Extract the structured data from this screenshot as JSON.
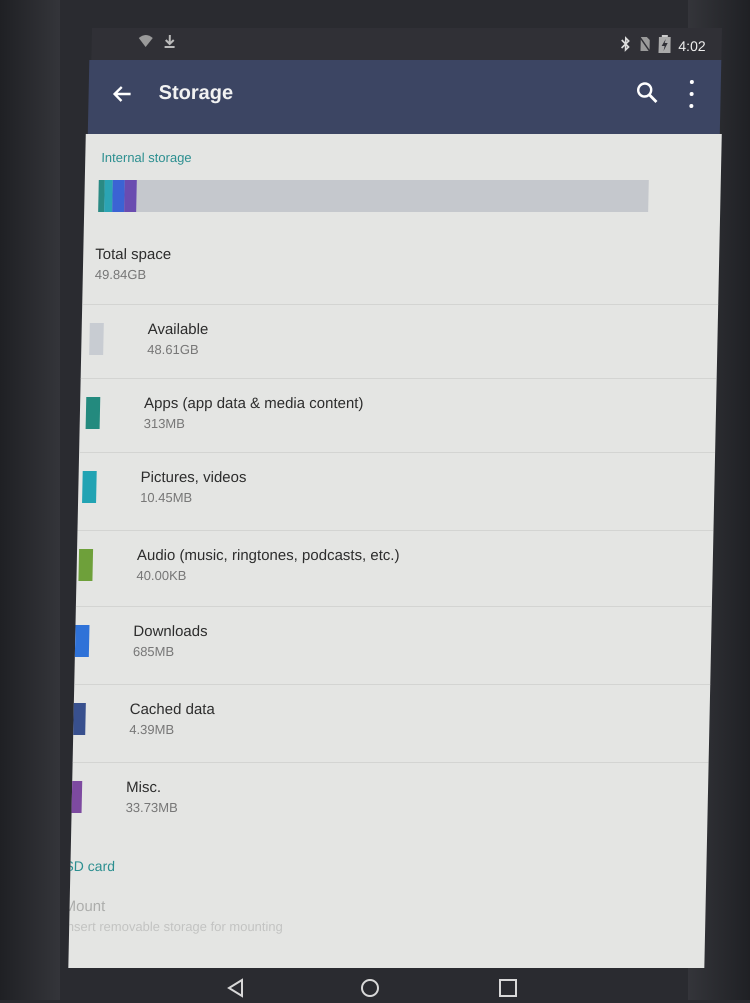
{
  "status_bar": {
    "left_icons": [
      "wifi-icon",
      "download-icon"
    ],
    "right_icons": [
      "bluetooth-icon",
      "no-sim-icon",
      "battery-icon"
    ],
    "time": "4:02"
  },
  "app_bar": {
    "title": "Storage",
    "icons": [
      "back-arrow-icon",
      "search-icon",
      "more-vert-icon"
    ]
  },
  "internal_storage": {
    "header": "Internal storage",
    "bar_segments": [
      {
        "color": "#2a8a84"
      },
      {
        "color": "#2ba4b4"
      },
      {
        "color": "#3b63d4"
      },
      {
        "color": "#6a4cb0"
      }
    ],
    "total": {
      "label": "Total space",
      "value": "49.84GB"
    },
    "items": [
      {
        "label": "Available",
        "value": "48.61GB",
        "color": "#c8ccd2"
      },
      {
        "label": "Apps (app data & media content)",
        "value": "313MB",
        "color": "#238a7e"
      },
      {
        "label": "Pictures, videos",
        "value": "10.45MB",
        "color": "#21a3b3"
      },
      {
        "label": "Audio (music, ringtones, podcasts, etc.)",
        "value": "40.00KB",
        "color": "#6ea03a"
      },
      {
        "label": "Downloads",
        "value": "685MB",
        "color": "#2f72d8"
      },
      {
        "label": "Cached data",
        "value": "4.39MB",
        "color": "#38508e"
      },
      {
        "label": "Misc.",
        "value": "33.73MB",
        "color": "#7d4aa0"
      }
    ]
  },
  "sd_card": {
    "header": "SD card",
    "mount_label": "Mount",
    "mount_sub": "Insert removable storage for mounting"
  },
  "nav_bar": {
    "buttons": [
      "back-triangle-icon",
      "home-circle-icon",
      "recents-square-icon"
    ]
  }
}
